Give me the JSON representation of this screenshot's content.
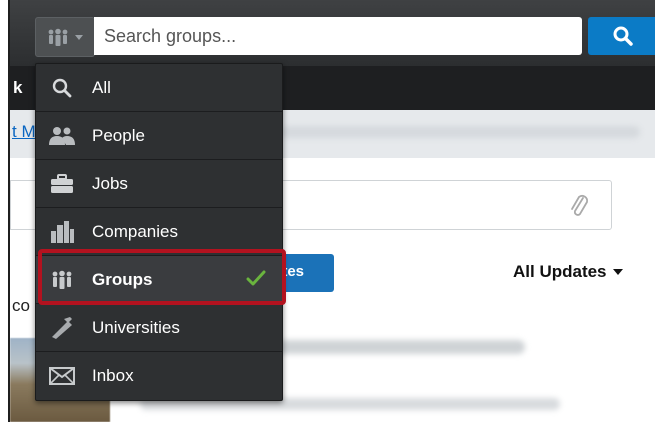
{
  "search": {
    "placeholder": "Search groups..."
  },
  "icons": {
    "scope": "groups-icon",
    "caret": "chevron-down-icon",
    "search": "search-icon",
    "attach": "paperclip-icon",
    "check": "checkmark-icon"
  },
  "colors": {
    "accent": "#0b7bc6",
    "menu_bg": "#2e3032",
    "check": "#6ab43e",
    "highlight": "#b3121f"
  },
  "menu": {
    "items": [
      {
        "label": "All",
        "icon": "search-icon"
      },
      {
        "label": "People",
        "icon": "people-icon"
      },
      {
        "label": "Jobs",
        "icon": "briefcase-icon"
      },
      {
        "label": "Companies",
        "icon": "buildings-icon"
      },
      {
        "label": "Groups",
        "icon": "groups-icon",
        "selected": true
      },
      {
        "label": "Universities",
        "icon": "university-icon"
      },
      {
        "label": "Inbox",
        "icon": "inbox-icon"
      }
    ]
  },
  "background": {
    "nav_fragment": "k",
    "link_fragment": "t M",
    "updates_button": "ates",
    "all_updates": "All Updates",
    "content_fragment": "co"
  }
}
